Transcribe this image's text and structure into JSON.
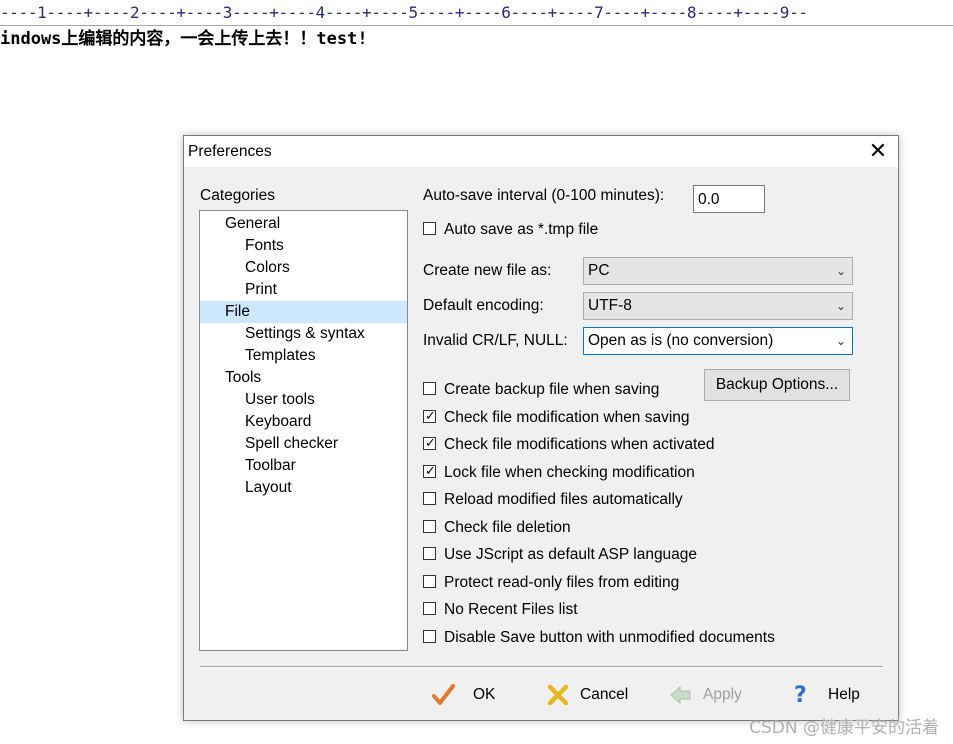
{
  "editor": {
    "ruler": "----1----+----2----+----3----+----4----+----5----+----6----+----7----+----8----+----9--",
    "line1": "indows上编辑的内容，一会上传上去！！test!"
  },
  "dialog": {
    "title": "Preferences",
    "close_glyph": "✕",
    "categories_label": "Categories",
    "tree": [
      {
        "label": "General",
        "level": 0
      },
      {
        "label": "Fonts",
        "level": 1
      },
      {
        "label": "Colors",
        "level": 1
      },
      {
        "label": "Print",
        "level": 1
      },
      {
        "label": "File",
        "level": 0,
        "selected": true
      },
      {
        "label": "Settings & syntax",
        "level": 1
      },
      {
        "label": "Templates",
        "level": 1
      },
      {
        "label": "Tools",
        "level": 0
      },
      {
        "label": "User tools",
        "level": 1
      },
      {
        "label": "Keyboard",
        "level": 1
      },
      {
        "label": "Spell checker",
        "level": 1
      },
      {
        "label": "Toolbar",
        "level": 1
      },
      {
        "label": "Layout",
        "level": 1
      }
    ],
    "autosave": {
      "label": "Auto-save interval (0-100 minutes):",
      "value": "0.0",
      "tmp_label": "Auto save as *.tmp file",
      "tmp_checked": false
    },
    "create_new_file": {
      "label": "Create new file as:",
      "value": "PC"
    },
    "default_encoding": {
      "label": "Default encoding:",
      "value": "UTF-8"
    },
    "invalid_crlf": {
      "label": "Invalid CR/LF, NULL:",
      "value": "Open as is (no conversion)"
    },
    "backup_options_label": "Backup Options...",
    "checkboxes": [
      {
        "label": "Create backup file when saving",
        "checked": false
      },
      {
        "label": "Check file modification when saving",
        "checked": true
      },
      {
        "label": "Check file modifications when activated",
        "checked": true
      },
      {
        "label": "Lock file when checking modification",
        "checked": true
      },
      {
        "label": "Reload modified files automatically",
        "checked": false
      },
      {
        "label": "Check file deletion",
        "checked": false
      },
      {
        "label": "Use JScript as default ASP language",
        "checked": false
      },
      {
        "label": "Protect read-only files from editing",
        "checked": false
      },
      {
        "label": "No Recent Files list",
        "checked": false
      },
      {
        "label": "Disable Save button with unmodified documents",
        "checked": false
      }
    ],
    "footer": {
      "ok": "OK",
      "cancel": "Cancel",
      "apply": "Apply",
      "help": "Help"
    }
  },
  "watermark": "CSDN @健康平安的活着",
  "colors": {
    "selection": "#cce8ff",
    "focus_border": "#0078d7",
    "ok_check": "#e07a30",
    "cancel_x": "#e6b820",
    "help_q": "#2f6fd0"
  }
}
